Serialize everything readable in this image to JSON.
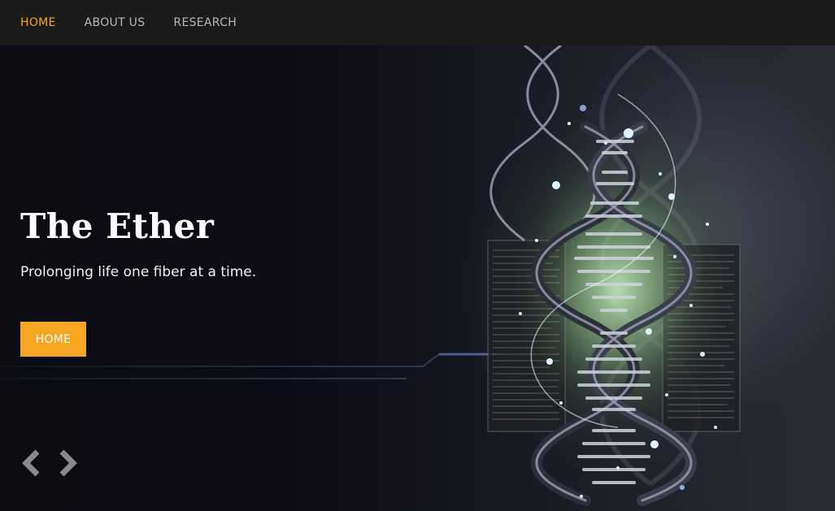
{
  "nav": {
    "items": [
      {
        "label": "HOME",
        "active": true
      },
      {
        "label": "ABOUT US",
        "active": false
      },
      {
        "label": "RESEARCH",
        "active": false
      }
    ]
  },
  "hero": {
    "title": "The Ether",
    "subtitle": "Prolonging life one fiber at a time.",
    "button_label": "HOME",
    "background_icon": "dna-helix-image",
    "controls": {
      "prev_icon": "chevron-left-icon",
      "next_icon": "chevron-right-icon"
    }
  },
  "colors": {
    "accent": "#f5a623",
    "navbar_bg": "#1b1b1b",
    "nav_text": "#b8b8b8",
    "hero_text": "#ffffff"
  }
}
